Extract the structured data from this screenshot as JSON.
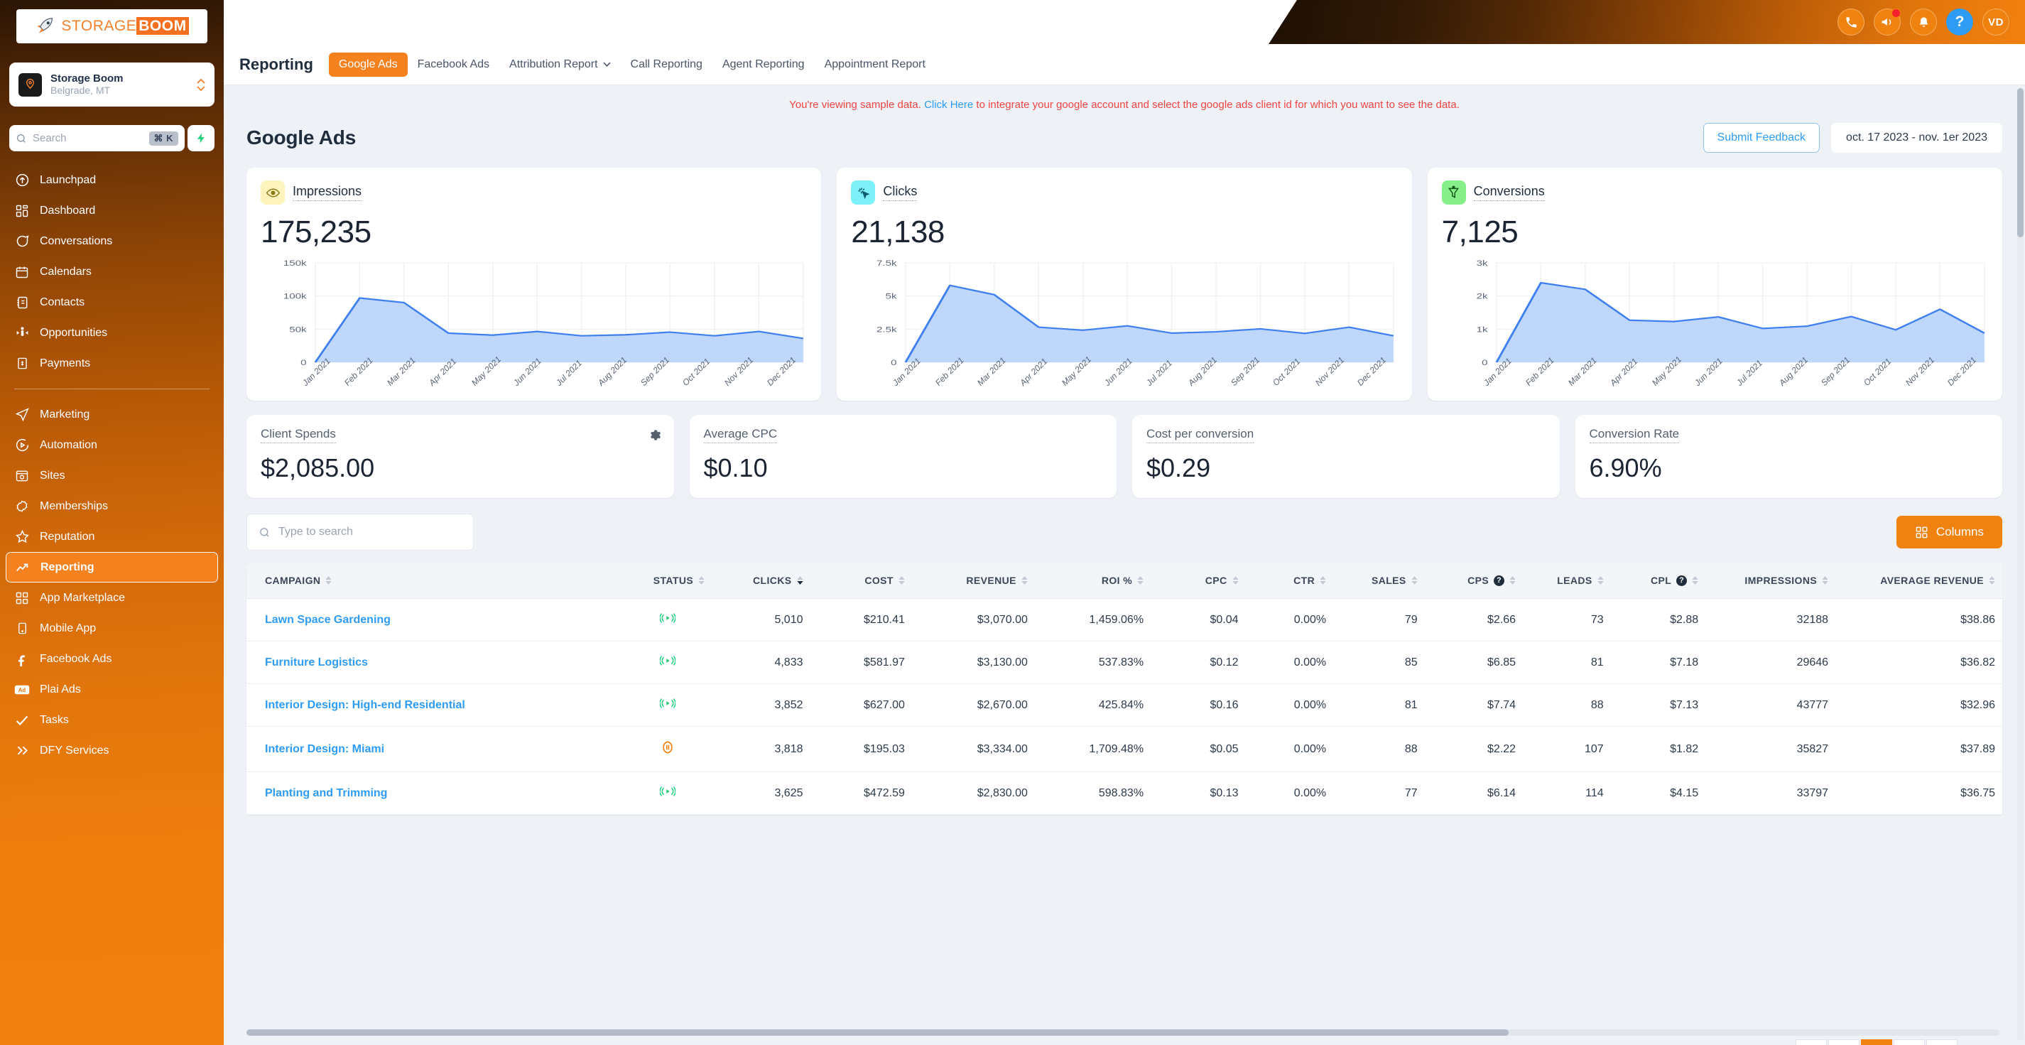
{
  "brand": {
    "logo_text_light": "STORAGE",
    "logo_text_bold": "BOOM"
  },
  "account": {
    "name": "Storage Boom",
    "location": "Belgrade, MT"
  },
  "search": {
    "placeholder": "Search",
    "shortcut": "⌘ K"
  },
  "sidebar": {
    "items_top": [
      {
        "label": "Launchpad",
        "icon": "rocket-launch-icon"
      },
      {
        "label": "Dashboard",
        "icon": "dashboard-grid-icon"
      },
      {
        "label": "Conversations",
        "icon": "chat-bubble-icon"
      },
      {
        "label": "Calendars",
        "icon": "calendar-icon"
      },
      {
        "label": "Contacts",
        "icon": "contacts-book-icon"
      },
      {
        "label": "Opportunities",
        "icon": "opportunities-icon"
      },
      {
        "label": "Payments",
        "icon": "payments-icon"
      }
    ],
    "items_bottom": [
      {
        "label": "Marketing",
        "icon": "paper-plane-icon",
        "active": false
      },
      {
        "label": "Automation",
        "icon": "automation-play-icon",
        "active": false
      },
      {
        "label": "Sites",
        "icon": "sites-browser-icon",
        "active": false
      },
      {
        "label": "Memberships",
        "icon": "membership-badge-icon",
        "active": false
      },
      {
        "label": "Reputation",
        "icon": "star-icon",
        "active": false
      },
      {
        "label": "Reporting",
        "icon": "trending-up-icon",
        "active": true
      },
      {
        "label": "App Marketplace",
        "icon": "apps-grid-icon",
        "active": false
      },
      {
        "label": "Mobile App",
        "icon": "mobile-phone-icon",
        "active": false
      },
      {
        "label": "Facebook Ads",
        "icon": "facebook-icon",
        "active": false
      },
      {
        "label": "Plai Ads",
        "icon": "ad-icon",
        "active": false
      },
      {
        "label": "Tasks",
        "icon": "check-icon",
        "active": false
      },
      {
        "label": "DFY Services",
        "icon": "chevron-double-right-icon",
        "active": false
      }
    ]
  },
  "topbar": {
    "icons": [
      {
        "name": "phone-icon",
        "glyph": "phone"
      },
      {
        "name": "megaphone-icon",
        "glyph": "megaphone",
        "badge": true
      },
      {
        "name": "bell-icon",
        "glyph": "bell"
      },
      {
        "name": "help-icon",
        "glyph": "?"
      }
    ],
    "avatar_initials": "VD"
  },
  "nav": {
    "title": "Reporting",
    "tabs": [
      {
        "label": "Google Ads",
        "active": true,
        "caret": false
      },
      {
        "label": "Facebook Ads",
        "active": false,
        "caret": false
      },
      {
        "label": "Attribution Report",
        "active": false,
        "caret": true
      },
      {
        "label": "Call Reporting",
        "active": false,
        "caret": false
      },
      {
        "label": "Agent Reporting",
        "active": false,
        "caret": false
      },
      {
        "label": "Appointment Report",
        "active": false,
        "caret": false
      }
    ]
  },
  "banner": {
    "prefix": "You're viewing sample data. ",
    "link": "Click Here",
    "suffix": " to integrate your google account and select the google ads client id for which you want to see the data."
  },
  "page": {
    "title": "Google Ads",
    "feedback_label": "Submit Feedback",
    "date_range": "oct. 17 2023 - nov. 1er 2023"
  },
  "kpis": [
    {
      "label": "Impressions",
      "value": "175,235",
      "icon": "eye-icon",
      "badge_color": "#fdf3bd"
    },
    {
      "label": "Clicks",
      "value": "21,138",
      "icon": "cursor-click-icon",
      "badge_color": "#7ef0f7"
    },
    {
      "label": "Conversions",
      "value": "7,125",
      "icon": "funnel-icon",
      "badge_color": "#86ef8a"
    }
  ],
  "kpis_small": [
    {
      "label": "Client Spends",
      "value": "$2,085.00",
      "gear": true
    },
    {
      "label": "Average CPC",
      "value": "$0.10",
      "gear": false
    },
    {
      "label": "Cost per conversion",
      "value": "$0.29",
      "gear": false
    },
    {
      "label": "Conversion Rate",
      "value": "6.90%",
      "gear": false
    }
  ],
  "table_toolbar": {
    "search_placeholder": "Type to search",
    "columns_label": "Columns"
  },
  "table": {
    "columns": [
      {
        "key": "campaign",
        "label": "CAMPAIGN",
        "align": "left",
        "sort": "none",
        "help": false
      },
      {
        "key": "status",
        "label": "STATUS",
        "align": "center",
        "sort": "none",
        "help": false
      },
      {
        "key": "clicks",
        "label": "CLICKS",
        "align": "right",
        "sort": "desc",
        "help": false
      },
      {
        "key": "cost",
        "label": "COST",
        "align": "right",
        "sort": "none",
        "help": false
      },
      {
        "key": "revenue",
        "label": "REVENUE",
        "align": "right",
        "sort": "none",
        "help": false
      },
      {
        "key": "roi",
        "label": "ROI %",
        "align": "right",
        "sort": "none",
        "help": false
      },
      {
        "key": "cpc",
        "label": "CPC",
        "align": "right",
        "sort": "none",
        "help": false
      },
      {
        "key": "ctr",
        "label": "CTR",
        "align": "right",
        "sort": "none",
        "help": false
      },
      {
        "key": "sales",
        "label": "SALES",
        "align": "right",
        "sort": "none",
        "help": false
      },
      {
        "key": "cps",
        "label": "CPS",
        "align": "right",
        "sort": "none",
        "help": true
      },
      {
        "key": "leads",
        "label": "LEADS",
        "align": "right",
        "sort": "none",
        "help": false
      },
      {
        "key": "cpl",
        "label": "CPL",
        "align": "right",
        "sort": "none",
        "help": true
      },
      {
        "key": "impressions",
        "label": "IMPRESSIONS",
        "align": "right",
        "sort": "none",
        "help": false
      },
      {
        "key": "avg_revenue",
        "label": "AVERAGE REVENUE",
        "align": "right",
        "sort": "none",
        "help": false
      }
    ],
    "rows": [
      {
        "campaign": "Lawn Space Gardening",
        "status": "active",
        "clicks": "5,010",
        "cost": "$210.41",
        "revenue": "$3,070.00",
        "roi": "1,459.06%",
        "cpc": "$0.04",
        "ctr": "0.00%",
        "sales": "79",
        "cps": "$2.66",
        "leads": "73",
        "cpl": "$2.88",
        "impressions": "32188",
        "avg_revenue": "$38.86"
      },
      {
        "campaign": "Furniture Logistics",
        "status": "active",
        "clicks": "4,833",
        "cost": "$581.97",
        "revenue": "$3,130.00",
        "roi": "537.83%",
        "cpc": "$0.12",
        "ctr": "0.00%",
        "sales": "85",
        "cps": "$6.85",
        "leads": "81",
        "cpl": "$7.18",
        "impressions": "29646",
        "avg_revenue": "$36.82"
      },
      {
        "campaign": "Interior Design: High-end Residential",
        "status": "active",
        "clicks": "3,852",
        "cost": "$627.00",
        "revenue": "$2,670.00",
        "roi": "425.84%",
        "cpc": "$0.16",
        "ctr": "0.00%",
        "sales": "81",
        "cps": "$7.74",
        "leads": "88",
        "cpl": "$7.13",
        "impressions": "43777",
        "avg_revenue": "$32.96"
      },
      {
        "campaign": "Interior Design: Miami",
        "status": "paused",
        "clicks": "3,818",
        "cost": "$195.03",
        "revenue": "$3,334.00",
        "roi": "1,709.48%",
        "cpc": "$0.05",
        "ctr": "0.00%",
        "sales": "88",
        "cps": "$2.22",
        "leads": "107",
        "cpl": "$1.82",
        "impressions": "35827",
        "avg_revenue": "$37.89"
      },
      {
        "campaign": "Planting and Trimming",
        "status": "active",
        "clicks": "3,625",
        "cost": "$472.59",
        "revenue": "$2,830.00",
        "roi": "598.83%",
        "cpc": "$0.13",
        "ctr": "0.00%",
        "sales": "77",
        "cps": "$6.14",
        "leads": "114",
        "cpl": "$4.15",
        "impressions": "33797",
        "avg_revenue": "$36.75"
      }
    ]
  },
  "chart_data": [
    {
      "type": "area",
      "title": "Impressions",
      "xlabel": "",
      "ylabel": "",
      "categories": [
        "Jan 2021",
        "Feb 2021",
        "Mar 2021",
        "Apr 2021",
        "May 2021",
        "Jun 2021",
        "Jul 2021",
        "Aug 2021",
        "Sep 2021",
        "Oct 2021",
        "Nov 2021",
        "Dec 2021"
      ],
      "values": [
        0,
        97000,
        90000,
        44000,
        41000,
        46500,
        40000,
        41500,
        45500,
        40000,
        46500,
        36000
      ],
      "ylim": [
        0,
        150000
      ],
      "yticks": [
        0,
        50000,
        100000,
        150000
      ],
      "ytick_labels": [
        "0",
        "50k",
        "100k",
        "150k"
      ],
      "grid": true,
      "legend": false,
      "line_color": "#3f7fef",
      "fill_color": "#bcd5fb"
    },
    {
      "type": "area",
      "title": "Clicks",
      "xlabel": "",
      "ylabel": "",
      "categories": [
        "Jan 2021",
        "Feb 2021",
        "Mar 2021",
        "Apr 2021",
        "May 2021",
        "Jun 2021",
        "Jul 2021",
        "Aug 2021",
        "Sep 2021",
        "Oct 2021",
        "Nov 2021",
        "Dec 2021"
      ],
      "values": [
        0,
        5800,
        5100,
        2650,
        2420,
        2750,
        2200,
        2300,
        2520,
        2180,
        2650,
        2000
      ],
      "ylim": [
        0,
        7500
      ],
      "yticks": [
        0,
        2500,
        5000,
        7500
      ],
      "ytick_labels": [
        "0",
        "2.5k",
        "5k",
        "7.5k"
      ],
      "grid": true,
      "legend": false,
      "line_color": "#3f7fef",
      "fill_color": "#bcd5fb"
    },
    {
      "type": "area",
      "title": "Conversions",
      "xlabel": "",
      "ylabel": "",
      "categories": [
        "Jan 2021",
        "Feb 2021",
        "Mar 2021",
        "Apr 2021",
        "May 2021",
        "Jun 2021",
        "Jul 2021",
        "Aug 2021",
        "Sep 2021",
        "Oct 2021",
        "Nov 2021",
        "Dec 2021"
      ],
      "values": [
        0,
        2400,
        2200,
        1270,
        1230,
        1370,
        1020,
        1090,
        1380,
        980,
        1600,
        880
      ],
      "ylim": [
        0,
        3000
      ],
      "yticks": [
        0,
        1000,
        2000,
        3000
      ],
      "ytick_labels": [
        "0",
        "1k",
        "2k",
        "3k"
      ],
      "grid": true,
      "legend": false,
      "line_color": "#3f7fef",
      "fill_color": "#bcd5fb"
    }
  ]
}
